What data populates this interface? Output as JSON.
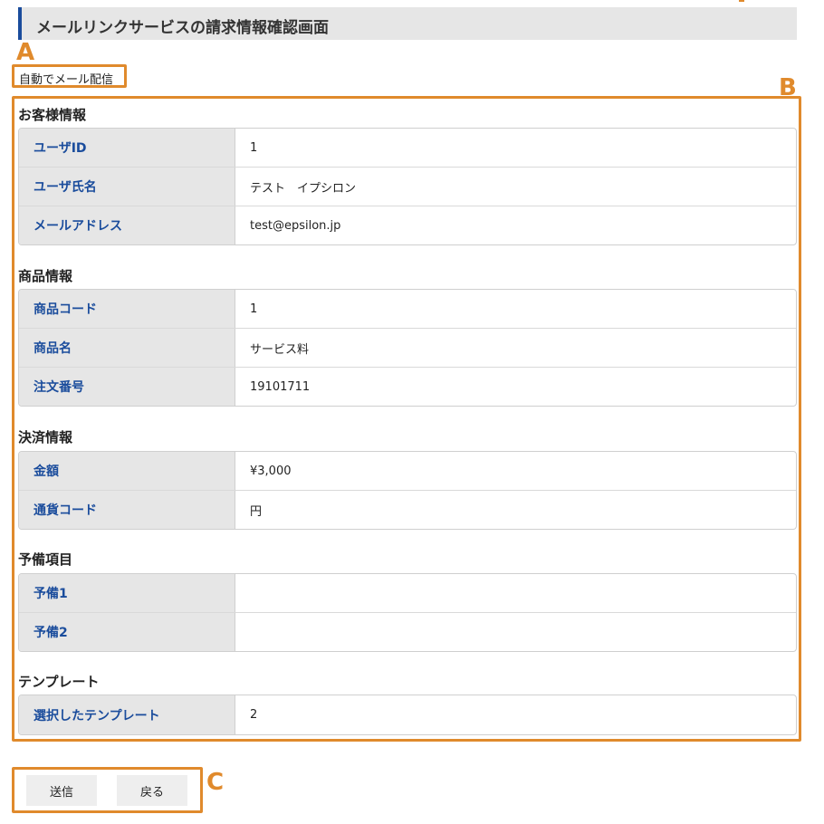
{
  "header": {
    "title": "メールリンクサービスの請求情報確認画面"
  },
  "callouts": {
    "a": "A",
    "b": "B",
    "c": "C"
  },
  "auto_mail_label": "自動でメール配信",
  "sections": {
    "customer": {
      "title": "お客様情報",
      "rows": [
        {
          "label": "ユーザID",
          "value": "1"
        },
        {
          "label": "ユーザ氏名",
          "value": "テスト　イプシロン"
        },
        {
          "label": "メールアドレス",
          "value": "test@epsilon.jp"
        }
      ]
    },
    "product": {
      "title": "商品情報",
      "rows": [
        {
          "label": "商品コード",
          "value": "1"
        },
        {
          "label": "商品名",
          "value": "サービス料"
        },
        {
          "label": "注文番号",
          "value": "19101711"
        }
      ]
    },
    "payment": {
      "title": "決済情報",
      "rows": [
        {
          "label": "金額",
          "value": "¥3,000"
        },
        {
          "label": "通貨コード",
          "value": "円"
        }
      ]
    },
    "reserve": {
      "title": "予備項目",
      "rows": [
        {
          "label": "予備1",
          "value": ""
        },
        {
          "label": "予備2",
          "value": ""
        }
      ]
    },
    "template": {
      "title": "テンプレート",
      "rows": [
        {
          "label": "選択したテンプレート",
          "value": "2"
        }
      ]
    }
  },
  "buttons": {
    "send": "送信",
    "back": "戻る"
  },
  "colors": {
    "accent": "#1a4c9c",
    "callout": "#e08a2c",
    "header_bg": "#e6e6e6"
  }
}
